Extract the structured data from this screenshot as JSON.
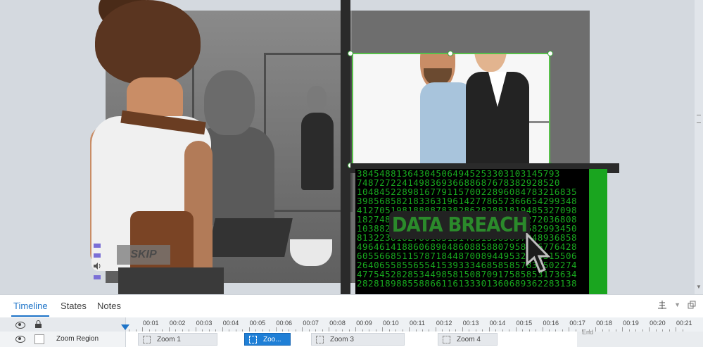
{
  "canvas": {
    "badge_text": "DATA BREACH",
    "skip_label": "SKIP",
    "matrix_lines": [
      "384548813643045064945253303103145793",
      "748727224149836936688687678382928520",
      "104845228981677911570022896084783216835",
      "398568582183363196142778657366654299348",
      "412705198188887838286282881819485327098",
      "182748862131617117174426262574272036808",
      "103882388811188313318612128757582993450",
      "813223818278618313148313385897948936858",
      "496461418860689048608858807958756776428",
      "605566851157871844870089449532025315506",
      "264065585565541539333468585857839502274",
      "477545282853449858150870917585853173634",
      "282818988558866116133301360689362283138"
    ]
  },
  "timeline": {
    "tabs": [
      "Timeline",
      "States",
      "Notes"
    ],
    "active_tab": "Timeline",
    "ruler_ticks": [
      "00:01",
      "00:02",
      "00:03",
      "00:04",
      "00:05",
      "00:06",
      "00:07",
      "00:08",
      "00:09",
      "00:10",
      "00:11",
      "00:12",
      "00:13",
      "00:14",
      "00:15",
      "00:16",
      "00:17",
      "00:18",
      "00:19",
      "00:20",
      "00:21"
    ],
    "track": {
      "name": "Zoom Region",
      "segments": [
        {
          "label": "Zoom 1",
          "selected": false
        },
        {
          "label": "Zoo...",
          "selected": true
        },
        {
          "label": "Zoom 3",
          "selected": false
        },
        {
          "label": "Zoom 4",
          "selected": false
        }
      ],
      "end_label": "End"
    }
  },
  "colors": {
    "accent": "#1e74c8",
    "matrix_green": "#1fd427",
    "badge_green": "#2b8a2b",
    "selection": "#57c04a"
  }
}
